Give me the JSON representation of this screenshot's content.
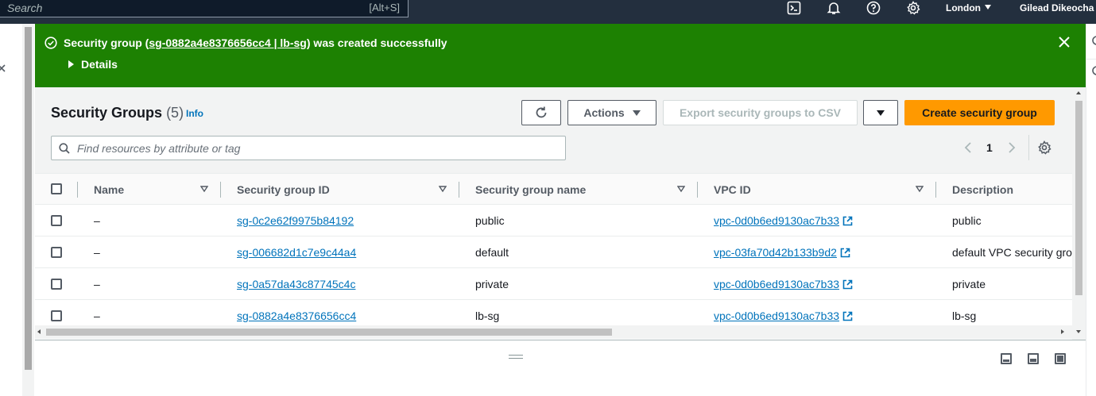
{
  "topnav": {
    "search_placeholder": "Search",
    "search_shortcut": "[Alt+S]",
    "region": "London",
    "user": "Gilead Dikeocha"
  },
  "flash": {
    "prefix": "Security group (",
    "link": "sg-0882a4e8376656cc4 | lb-sg",
    "suffix": ") was created successfully",
    "details_label": "Details"
  },
  "panel": {
    "title": "Security Groups",
    "count": "(5)",
    "info": "Info",
    "actions_label": "Actions",
    "export_label": "Export security groups to CSV",
    "create_label": "Create security group",
    "filter_placeholder": "Find resources by attribute or tag",
    "page": "1"
  },
  "table": {
    "columns": [
      "Name",
      "Security group ID",
      "Security group name",
      "VPC ID",
      "Description"
    ],
    "rows": [
      {
        "name": "–",
        "id": "sg-0c2e62f9975b84192",
        "group_name": "public",
        "vpc": "vpc-0d0b6ed9130ac7b33",
        "description": "public"
      },
      {
        "name": "–",
        "id": "sg-006682d1c7e9c44a4",
        "group_name": "default",
        "vpc": "vpc-03fa70d42b133b9d2",
        "description": "default VPC security gro"
      },
      {
        "name": "–",
        "id": "sg-0a57da43c87745c4c",
        "group_name": "private",
        "vpc": "vpc-0d0b6ed9130ac7b33",
        "description": "private"
      },
      {
        "name": "–",
        "id": "sg-0882a4e8376656cc4",
        "group_name": "lb-sg",
        "vpc": "vpc-0d0b6ed9130ac7b33",
        "description": "lb-sg"
      }
    ]
  },
  "colors": {
    "nav_bg": "#232f3e",
    "success": "#1d8102",
    "primary": "#ff9900",
    "link": "#0073bb"
  }
}
